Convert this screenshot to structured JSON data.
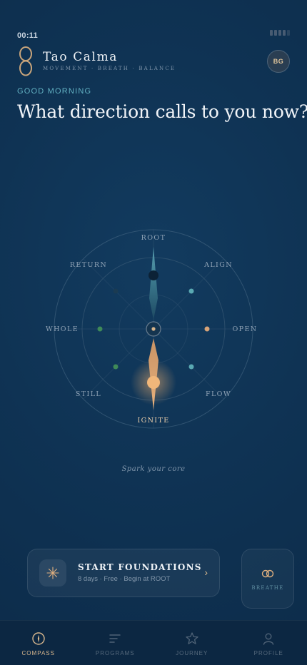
{
  "status": {
    "time": "00:11"
  },
  "app": {
    "name": "Tao Calma",
    "tagline": "MOVEMENT · BREATH · BALANCE",
    "avatar_initials": "BG"
  },
  "greeting": "GOOD MORNING",
  "headline": "What direction calls to you now?",
  "compass": {
    "directions": [
      "ROOT",
      "ALIGN",
      "OPEN",
      "FLOW",
      "IGNITE",
      "STILL",
      "WHOLE",
      "RETURN"
    ],
    "selected": "IGNITE",
    "description": "Spark your core"
  },
  "start_card": {
    "title": "START FOUNDATIONS",
    "subtitle": "8 days · Free · Begin at ROOT",
    "chevron": "›"
  },
  "breathe": {
    "label": "BREATHE"
  },
  "nav": [
    {
      "label": "COMPASS",
      "icon": "compass-icon",
      "active": true
    },
    {
      "label": "PROGRAMS",
      "icon": "programs-icon",
      "active": false
    },
    {
      "label": "JOURNEY",
      "icon": "star-icon",
      "active": false
    },
    {
      "label": "PROFILE",
      "icon": "profile-icon",
      "active": false
    }
  ],
  "colors": {
    "accent_gold": "#e8b27a",
    "accent_teal": "#5aa9b3",
    "accent_green": "#3f8a58",
    "background": "#0f3354"
  }
}
